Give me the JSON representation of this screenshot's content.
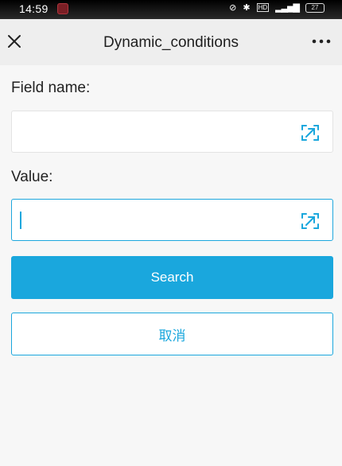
{
  "status": {
    "time": "14:59",
    "battery": "27"
  },
  "header": {
    "title": "Dynamic_conditions"
  },
  "form": {
    "field_name_label": "Field name:",
    "field_name_value": "",
    "value_label": "Value:",
    "value_value": ""
  },
  "actions": {
    "search_label": "Search",
    "cancel_label": "取消"
  },
  "colors": {
    "accent": "#1aa7dd",
    "header_bg": "#eeeeee",
    "page_bg": "#f7f7f7"
  },
  "icons": [
    "close-icon",
    "more-icon",
    "scan-icon"
  ]
}
